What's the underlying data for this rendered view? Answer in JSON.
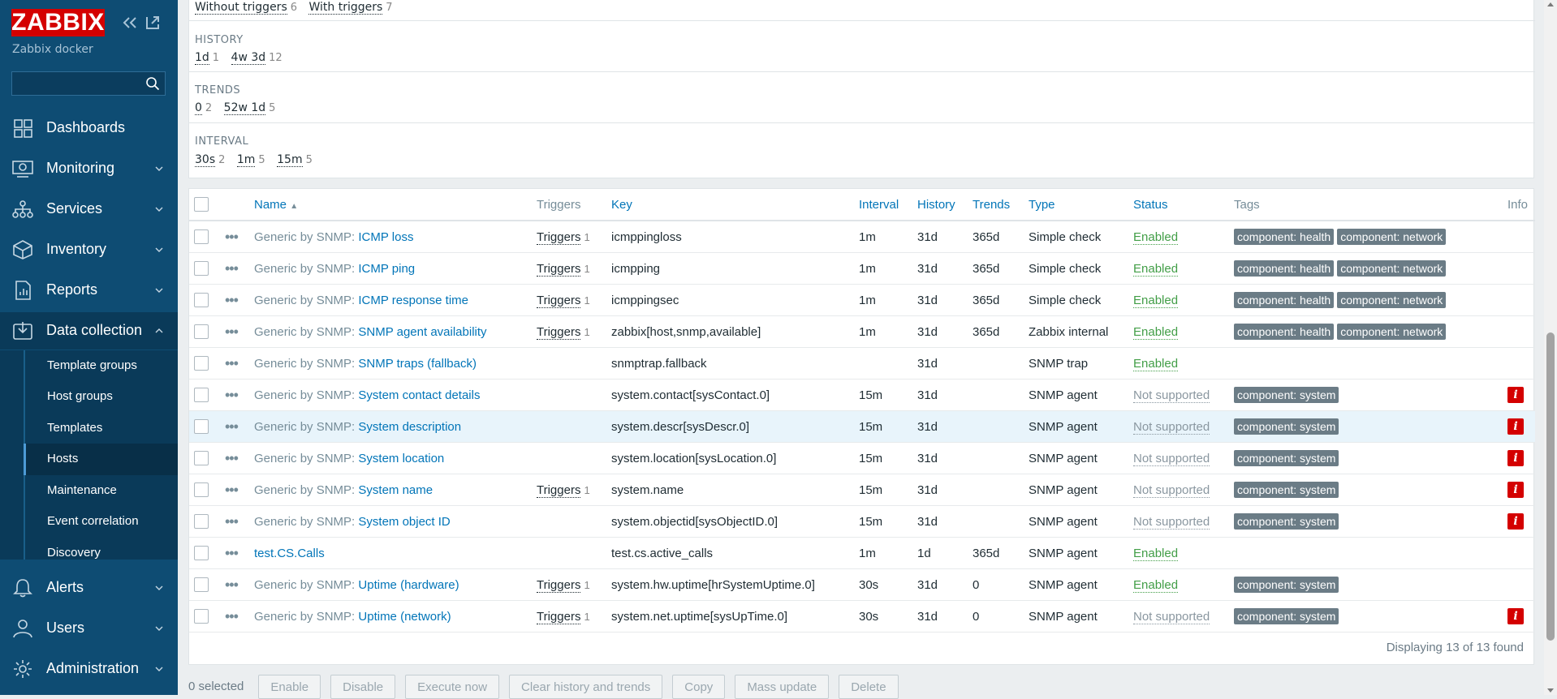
{
  "sidebar": {
    "logo": "ZABBIX",
    "server_name": "Zabbix docker",
    "search_placeholder": "",
    "menu": [
      {
        "label": "Dashboards",
        "icon": "dashboard-icon"
      },
      {
        "label": "Monitoring",
        "icon": "monitoring-icon"
      },
      {
        "label": "Services",
        "icon": "services-icon"
      },
      {
        "label": "Inventory",
        "icon": "inventory-icon"
      },
      {
        "label": "Reports",
        "icon": "reports-icon"
      },
      {
        "label": "Data collection",
        "icon": "data-collection-icon"
      },
      {
        "label": "Alerts",
        "icon": "alerts-icon"
      },
      {
        "label": "Users",
        "icon": "users-icon"
      },
      {
        "label": "Administration",
        "icon": "administration-icon"
      }
    ],
    "submenu": [
      {
        "label": "Template groups"
      },
      {
        "label": "Host groups"
      },
      {
        "label": "Templates"
      },
      {
        "label": "Hosts"
      },
      {
        "label": "Maintenance"
      },
      {
        "label": "Event correlation"
      },
      {
        "label": "Discovery"
      }
    ],
    "active_submenu": "Hosts"
  },
  "filter": {
    "triggers_row": [
      {
        "label": "Without triggers",
        "count": "6"
      },
      {
        "label": "With triggers",
        "count": "7"
      }
    ],
    "history": {
      "title": "HISTORY",
      "values": [
        {
          "label": "1d",
          "count": "1"
        },
        {
          "label": "4w 3d",
          "count": "12"
        }
      ]
    },
    "trends": {
      "title": "TRENDS",
      "values": [
        {
          "label": "0",
          "count": "2"
        },
        {
          "label": "52w 1d",
          "count": "5"
        }
      ]
    },
    "interval": {
      "title": "INTERVAL",
      "values": [
        {
          "label": "30s",
          "count": "2"
        },
        {
          "label": "1m",
          "count": "5"
        },
        {
          "label": "15m",
          "count": "5"
        }
      ]
    }
  },
  "table": {
    "headers": {
      "name": "Name",
      "triggers": "Triggers",
      "key": "Key",
      "interval": "Interval",
      "history": "History",
      "trends": "Trends",
      "type": "Type",
      "status": "Status",
      "tags": "Tags",
      "info": "Info"
    },
    "rows": [
      {
        "tpl": "Generic by SNMP",
        "name": "ICMP loss",
        "triggers": "Triggers",
        "trig_count": "1",
        "key": "icmppingloss",
        "interval": "1m",
        "history": "31d",
        "trends": "365d",
        "type": "Simple check",
        "status": "Enabled",
        "tags": [
          "component: health",
          "component: network"
        ],
        "info": false
      },
      {
        "tpl": "Generic by SNMP",
        "name": "ICMP ping",
        "triggers": "Triggers",
        "trig_count": "1",
        "key": "icmpping",
        "interval": "1m",
        "history": "31d",
        "trends": "365d",
        "type": "Simple check",
        "status": "Enabled",
        "tags": [
          "component: health",
          "component: network"
        ],
        "info": false
      },
      {
        "tpl": "Generic by SNMP",
        "name": "ICMP response time",
        "triggers": "Triggers",
        "trig_count": "1",
        "key": "icmppingsec",
        "interval": "1m",
        "history": "31d",
        "trends": "365d",
        "type": "Simple check",
        "status": "Enabled",
        "tags": [
          "component: health",
          "component: network"
        ],
        "info": false
      },
      {
        "tpl": "Generic by SNMP",
        "name": "SNMP agent availability",
        "triggers": "Triggers",
        "trig_count": "1",
        "key": "zabbix[host,snmp,available]",
        "interval": "1m",
        "history": "31d",
        "trends": "365d",
        "type": "Zabbix internal",
        "status": "Enabled",
        "tags": [
          "component: health",
          "component: network"
        ],
        "info": false
      },
      {
        "tpl": "Generic by SNMP",
        "name": "SNMP traps (fallback)",
        "triggers": "",
        "trig_count": "",
        "key": "snmptrap.fallback",
        "interval": "",
        "history": "31d",
        "trends": "",
        "type": "SNMP trap",
        "status": "Enabled",
        "tags": [],
        "info": false
      },
      {
        "tpl": "Generic by SNMP",
        "name": "System contact details",
        "triggers": "",
        "trig_count": "",
        "key": "system.contact[sysContact.0]",
        "interval": "15m",
        "history": "31d",
        "trends": "",
        "type": "SNMP agent",
        "status": "Not supported",
        "tags": [
          "component: system"
        ],
        "info": true
      },
      {
        "tpl": "Generic by SNMP",
        "name": "System description",
        "triggers": "",
        "trig_count": "",
        "key": "system.descr[sysDescr.0]",
        "interval": "15m",
        "history": "31d",
        "trends": "",
        "type": "SNMP agent",
        "status": "Not supported",
        "tags": [
          "component: system"
        ],
        "info": true,
        "highlight": true
      },
      {
        "tpl": "Generic by SNMP",
        "name": "System location",
        "triggers": "",
        "trig_count": "",
        "key": "system.location[sysLocation.0]",
        "interval": "15m",
        "history": "31d",
        "trends": "",
        "type": "SNMP agent",
        "status": "Not supported",
        "tags": [
          "component: system"
        ],
        "info": true
      },
      {
        "tpl": "Generic by SNMP",
        "name": "System name",
        "triggers": "Triggers",
        "trig_count": "1",
        "key": "system.name",
        "interval": "15m",
        "history": "31d",
        "trends": "",
        "type": "SNMP agent",
        "status": "Not supported",
        "tags": [
          "component: system"
        ],
        "info": true
      },
      {
        "tpl": "Generic by SNMP",
        "name": "System object ID",
        "triggers": "",
        "trig_count": "",
        "key": "system.objectid[sysObjectID.0]",
        "interval": "15m",
        "history": "31d",
        "trends": "",
        "type": "SNMP agent",
        "status": "Not supported",
        "tags": [
          "component: system"
        ],
        "info": true
      },
      {
        "tpl": "",
        "name": "test.CS.Calls",
        "triggers": "",
        "trig_count": "",
        "key": "test.cs.active_calls",
        "interval": "1m",
        "history": "1d",
        "trends": "365d",
        "type": "SNMP agent",
        "status": "Enabled",
        "tags": [],
        "info": false
      },
      {
        "tpl": "Generic by SNMP",
        "name": "Uptime (hardware)",
        "triggers": "Triggers",
        "trig_count": "1",
        "key": "system.hw.uptime[hrSystemUptime.0]",
        "interval": "30s",
        "history": "31d",
        "trends": "0",
        "type": "SNMP agent",
        "status": "Enabled",
        "tags": [
          "component: system"
        ],
        "info": false
      },
      {
        "tpl": "Generic by SNMP",
        "name": "Uptime (network)",
        "triggers": "Triggers",
        "trig_count": "1",
        "key": "system.net.uptime[sysUpTime.0]",
        "interval": "30s",
        "history": "31d",
        "trends": "0",
        "type": "SNMP agent",
        "status": "Not supported",
        "tags": [
          "component: system"
        ],
        "info": true
      }
    ],
    "displaying": "Displaying 13 of 13 found"
  },
  "actions": {
    "selected": "0 selected",
    "buttons": [
      "Enable",
      "Disable",
      "Execute now",
      "Clear history and trends",
      "Copy",
      "Mass update",
      "Delete"
    ]
  },
  "colors": {
    "sidebar_bg": "#0e4c73",
    "logo_red": "#d40000",
    "link_blue": "#0275b8",
    "enabled_green": "#429e47",
    "tag_gray": "#6b7c86"
  }
}
